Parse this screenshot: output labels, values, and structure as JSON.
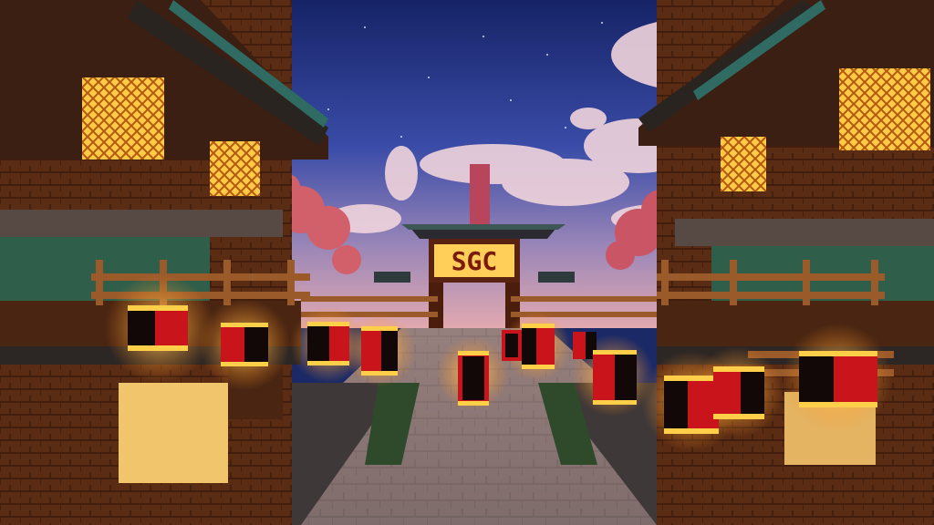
{
  "scene": {
    "gate_sign_text": "SGC",
    "palette": {
      "sky_top": "#1a2a78",
      "sky_mid": "#3b4fae",
      "sky_horizon": "#c98fa6",
      "cloud": "#f2d9e0",
      "wood_dark": "#3a1d10",
      "wood": "#6b3418",
      "roof": "#2f2420",
      "lantern_red": "#c8141a",
      "lantern_black": "#120807",
      "lantern_glow": "#ffcf4a",
      "window_glow": "#ffb02a",
      "leaves": "#2f5e4a",
      "blossom": "#d4606e",
      "path_stone": "#8e7b7c",
      "path_dark": "#4b3c3c"
    },
    "objects": [
      "left-pagoda-building",
      "right-pagoda-building",
      "sgc-gate",
      "paper-lanterns",
      "wooden-fences",
      "cherry-blossom-trees",
      "stone-path",
      "starry-sky"
    ]
  }
}
